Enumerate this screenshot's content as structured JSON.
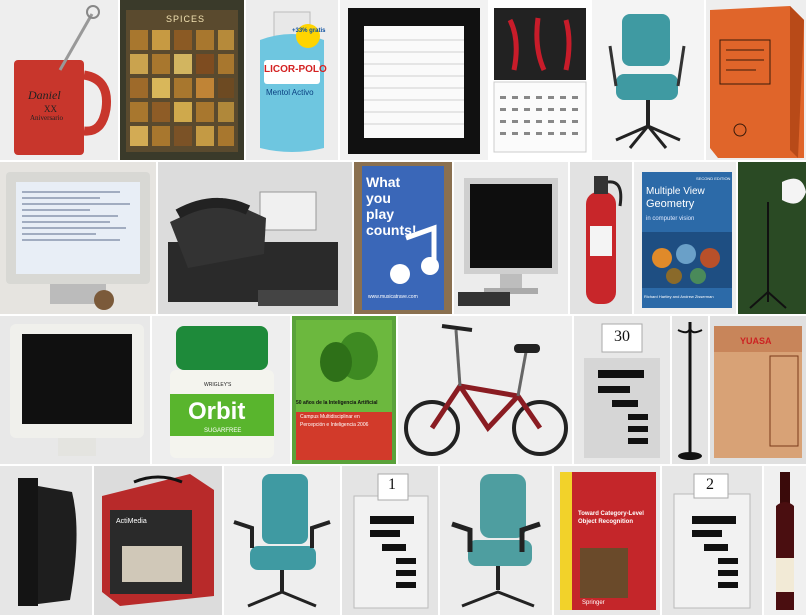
{
  "mosaic": {
    "mug": {
      "line1": "Daniel",
      "line2": "XX",
      "line3": "Aniversario"
    },
    "spices": {
      "label": "SPICES"
    },
    "mouthwash": {
      "badge": "+33% gratis",
      "brand": "LICOR-POLO",
      "variant": "Mentol Activo"
    },
    "poster_music": {
      "line1": "What",
      "line2": "you",
      "line3": "play",
      "line4": "counts!",
      "url": "www.musicatrave.com"
    },
    "book_mvg": {
      "title1": "Multiple View",
      "title2": "Geometry",
      "subtitle": "in computer vision",
      "authors": "Richard Hartley and Andrew Zisserman",
      "edition": "SECOND EDITION"
    },
    "gum": {
      "brand_top": "WRIGLEY'S",
      "brand": "Orbit",
      "sub": "SUGARFREE"
    },
    "poster_ai": {
      "title": "50 años de la Inteligencia Artificial",
      "line2": "Campus Multidisciplinar en",
      "line3": "Percepción e Inteligencia 2006"
    },
    "numbered_box_30": {
      "label": "30"
    },
    "battery": {
      "brand": "YUASA"
    },
    "shredder": {
      "brand": "ActiMedia"
    },
    "numbered_box_1": {
      "label": "1"
    },
    "book_toward": {
      "title": "Toward Category-Level Object Recognition",
      "publisher": "Springer"
    },
    "numbered_box_2": {
      "label": "2"
    },
    "colors": {
      "red": "#c8362c",
      "teal": "#3f9aa2",
      "orange": "#e0652a",
      "blue": "#3a67b8",
      "green": "#59b52d"
    }
  }
}
